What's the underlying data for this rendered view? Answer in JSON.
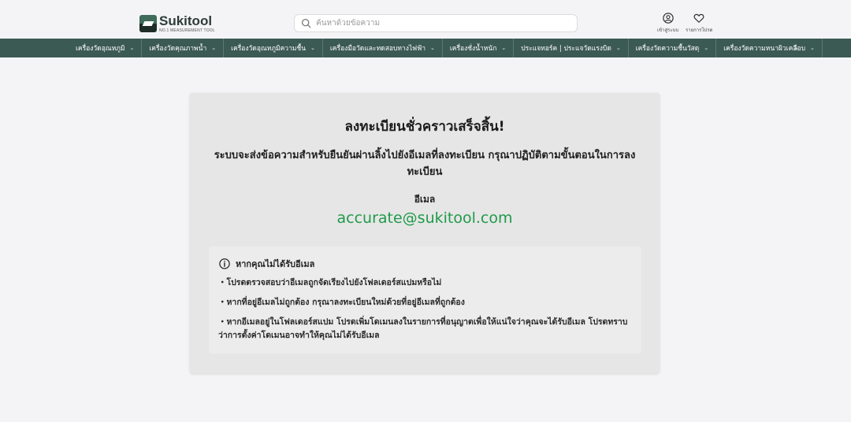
{
  "header": {
    "logo_name": "Sukitool",
    "logo_sub": "NO.1 MEASUREMENT TOOL",
    "search_placeholder": "ค้นหาด้วยข้อความ",
    "login_label": "เข้าสู่ระบบ",
    "wishlist_label": "รายการโปรด"
  },
  "nav": {
    "items": [
      "เครื่องวัดอุณหภูมิ",
      "เครื่องวัดคุณภาพน้ำ",
      "เครื่องวัดอุณหภูมิความชื้น",
      "เครื่องมือวัดและทดสอบทางไฟฟ้า",
      "เครื่องชั่งน้ำหนัก",
      "ประแจทอร์ค | ประแจวัดแรงบิด",
      "เครื่องวัดความชื้นวัสดุ",
      "เครื่องวัดความหนาผิวเคลือบ"
    ],
    "next_icon": "chevron-right-icon"
  },
  "card": {
    "title": "ลงทะเบียนชั่วคราวเสร็จสิ้น!",
    "description": "ระบบจะส่งข้อความสำหรับยืนยันผ่านลิ้งไปยังอีเมลที่ลงทะเบียน กรุณาปฏิบัติตามขั้นตอนในการลงทะเบียน",
    "email_label": "อีเมล",
    "email_value": "accurate@sukitool.com",
    "email_color": "#1f9a4a"
  },
  "help": {
    "heading": "หากคุณไม่ได้รับอีเมล",
    "items": [
      "・โปรดตรวจสอบว่าอีเมลถูกจัดเรียงไปยังโฟลเดอร์สแปมหรือไม่",
      "・หากที่อยู่อีเมลไม่ถูกต้อง กรุณาลงทะเบียนใหม่ด้วยที่อยู่อีเมลที่ถูกต้อง",
      "・หากอีเมลอยู่ในโฟลเดอร์สแปม โปรดเพิ่มโดเมนลงในรายการที่อนุญาตเพื่อให้แน่ใจว่าคุณจะได้รับอีเมล โปรดทราบว่าการตั้งค่าโดเมนอาจทำให้คุณไม่ได้รับอีเมล"
    ]
  },
  "colors": {
    "nav_bg": "#3c5a54",
    "card_bg": "#e6e6e6",
    "brand": "#3e6b5a"
  }
}
